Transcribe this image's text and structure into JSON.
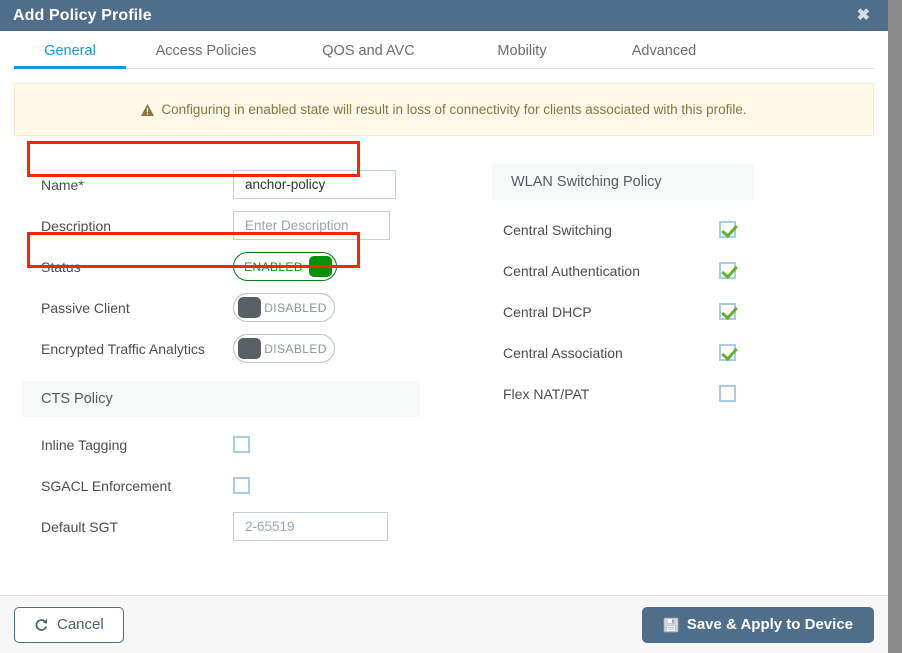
{
  "window": {
    "title": "Add Policy Profile",
    "close_icon": "close-icon",
    "close_glyph": "✖"
  },
  "tabs": [
    {
      "label": "General",
      "active": true
    },
    {
      "label": "Access Policies",
      "active": false
    },
    {
      "label": "QOS and AVC",
      "active": false
    },
    {
      "label": "Mobility",
      "active": false
    },
    {
      "label": "Advanced",
      "active": false
    }
  ],
  "warning": {
    "icon": "warning-triangle-icon",
    "text": "Configuring in enabled state will result in loss of connectivity for clients associated with this profile."
  },
  "form": {
    "name": {
      "label": "Name*",
      "value": "anchor-policy",
      "placeholder": ""
    },
    "description": {
      "label": "Description",
      "value": "",
      "placeholder": "Enter Description"
    },
    "status": {
      "label": "Status",
      "state": "ENABLED",
      "on": true
    },
    "passive_client": {
      "label": "Passive Client",
      "state": "DISABLED",
      "on": false
    },
    "encrypted_traffic_analytics": {
      "label": "Encrypted Traffic Analytics",
      "state": "DISABLED",
      "on": false
    }
  },
  "cts_policy": {
    "title": "CTS Policy",
    "items": [
      {
        "label": "Inline Tagging",
        "checked": false
      },
      {
        "label": "SGACL Enforcement",
        "checked": false
      }
    ],
    "default_sgt": {
      "label": "Default SGT",
      "value": "",
      "placeholder": "2-65519"
    }
  },
  "wlan_switching_policy": {
    "title": "WLAN Switching Policy",
    "items": [
      {
        "label": "Central Switching",
        "checked": true
      },
      {
        "label": "Central Authentication",
        "checked": true
      },
      {
        "label": "Central DHCP",
        "checked": true
      },
      {
        "label": "Central Association",
        "checked": true
      },
      {
        "label": "Flex NAT/PAT",
        "checked": false
      }
    ]
  },
  "footer": {
    "cancel": {
      "label": "Cancel",
      "icon": "undo-arrow-icon"
    },
    "save": {
      "label": "Save & Apply to Device",
      "icon": "floppy-save-icon"
    }
  },
  "annotations": {
    "highlight_color": "#fa2600",
    "boxes": [
      {
        "target": "name-row"
      },
      {
        "target": "status-row"
      }
    ]
  },
  "colors": {
    "titlebar": "#4e6e8a",
    "active_tab": "#149ad6",
    "warning_bg": "#fdf8e7",
    "warning_text": "#8a7441",
    "toggle_on": "#039106",
    "toggle_off": "#5b6066",
    "check": "#62b22e",
    "primary_button": "#4e6e8a"
  }
}
